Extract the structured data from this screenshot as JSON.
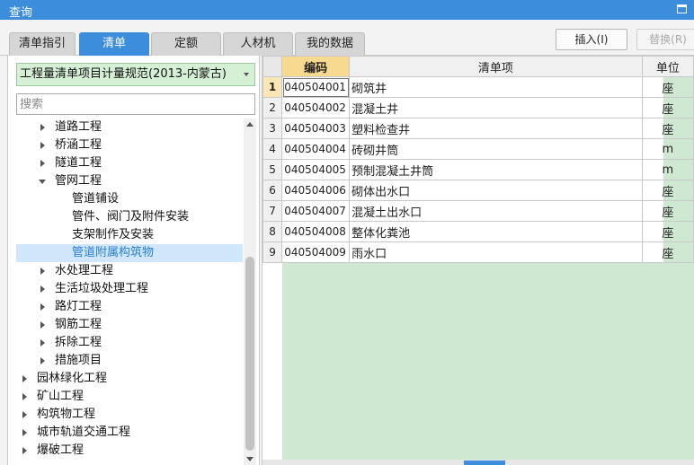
{
  "window": {
    "title": "查询"
  },
  "tabs": [
    {
      "label": "清单指引",
      "active": false
    },
    {
      "label": "清单",
      "active": true
    },
    {
      "label": "定额",
      "active": false
    },
    {
      "label": "人材机",
      "active": false
    },
    {
      "label": "我的数据",
      "active": false
    }
  ],
  "toolbar": {
    "insert_label": "插入(I)",
    "replace_label": "替换(R)"
  },
  "left": {
    "spec_selected": "工程量清单项目计量规范(2013-内蒙古)",
    "search_placeholder": "搜索",
    "tree": [
      {
        "label": "道路工程",
        "level": 1,
        "caret": "right"
      },
      {
        "label": "桥涵工程",
        "level": 1,
        "caret": "right"
      },
      {
        "label": "隧道工程",
        "level": 1,
        "caret": "right"
      },
      {
        "label": "管网工程",
        "level": 1,
        "caret": "down"
      },
      {
        "label": "管道铺设",
        "level": 2,
        "caret": "none"
      },
      {
        "label": "管件、阀门及附件安装",
        "level": 2,
        "caret": "none"
      },
      {
        "label": "支架制作及安装",
        "level": 2,
        "caret": "none"
      },
      {
        "label": "管道附属构筑物",
        "level": 2,
        "caret": "none",
        "selected": true
      },
      {
        "label": "水处理工程",
        "level": 1,
        "caret": "right"
      },
      {
        "label": "生活垃圾处理工程",
        "level": 1,
        "caret": "right"
      },
      {
        "label": "路灯工程",
        "level": 1,
        "caret": "right"
      },
      {
        "label": "钢筋工程",
        "level": 1,
        "caret": "right"
      },
      {
        "label": "拆除工程",
        "level": 1,
        "caret": "right"
      },
      {
        "label": "措施项目",
        "level": 1,
        "caret": "right"
      },
      {
        "label": "园林绿化工程",
        "level": 0,
        "caret": "right"
      },
      {
        "label": "矿山工程",
        "level": 0,
        "caret": "right"
      },
      {
        "label": "构筑物工程",
        "level": 0,
        "caret": "right"
      },
      {
        "label": "城市轨道交通工程",
        "level": 0,
        "caret": "right"
      },
      {
        "label": "爆破工程",
        "level": 0,
        "caret": "right"
      }
    ]
  },
  "grid": {
    "headers": {
      "code": "编码",
      "name": "清单项",
      "unit": "单位"
    },
    "rows": [
      {
        "num": "1",
        "code": "040504001",
        "name": "砌筑井",
        "unit": "座"
      },
      {
        "num": "2",
        "code": "040504002",
        "name": "混凝土井",
        "unit": "座"
      },
      {
        "num": "3",
        "code": "040504003",
        "name": "塑料检查井",
        "unit": "座"
      },
      {
        "num": "4",
        "code": "040504004",
        "name": "砖砌井筒",
        "unit": "m"
      },
      {
        "num": "5",
        "code": "040504005",
        "name": "预制混凝土井筒",
        "unit": "m"
      },
      {
        "num": "6",
        "code": "040504006",
        "name": "砌体出水口",
        "unit": "座"
      },
      {
        "num": "7",
        "code": "040504007",
        "name": "混凝土出水口",
        "unit": "座"
      },
      {
        "num": "8",
        "code": "040504008",
        "name": "整体化粪池",
        "unit": "座"
      },
      {
        "num": "9",
        "code": "040504009",
        "name": "雨水口",
        "unit": "座"
      }
    ]
  }
}
